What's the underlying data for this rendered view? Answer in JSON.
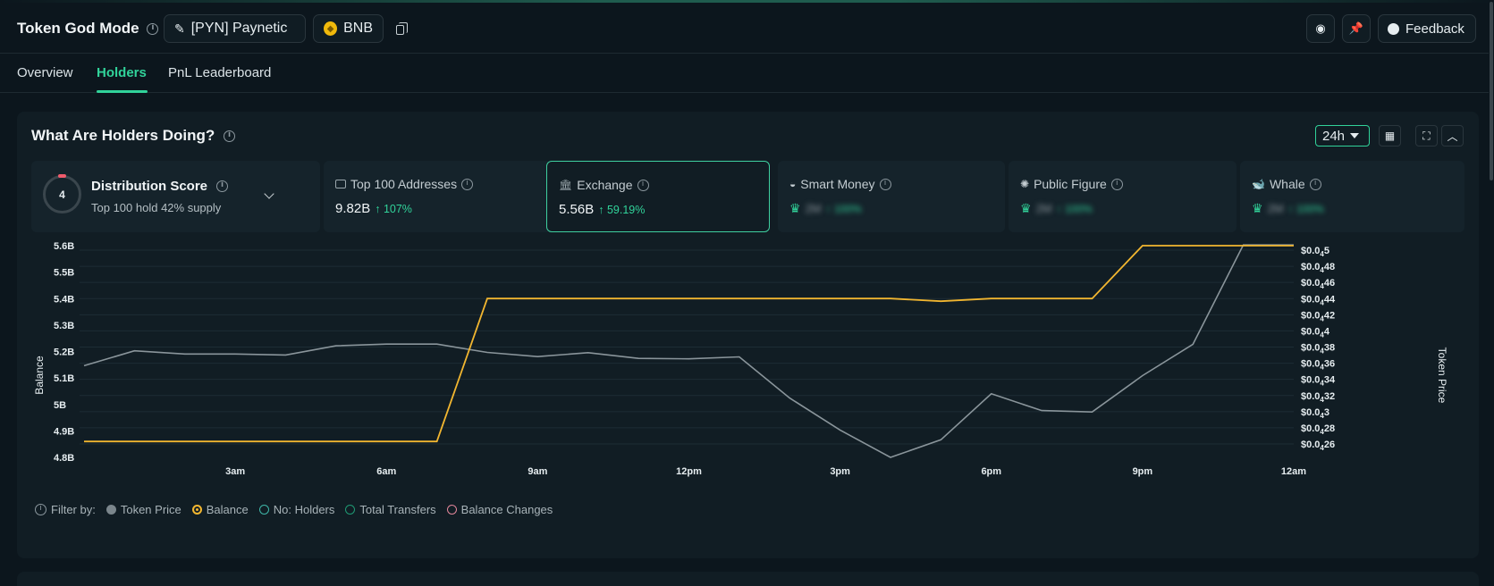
{
  "header": {
    "title": "Token God Mode",
    "token_label": "[PYN] Paynetic",
    "chain_label": "BNB",
    "feedback_label": "Feedback"
  },
  "tabs": [
    {
      "label": "Overview",
      "active": false
    },
    {
      "label": "Holders",
      "active": true
    },
    {
      "label": "PnL Leaderboard",
      "active": false
    }
  ],
  "panel": {
    "title": "What Are Holders Doing?",
    "range": "24h"
  },
  "distribution": {
    "score": "4",
    "title": "Distribution Score",
    "subtitle": "Top 100 hold 42% supply"
  },
  "cards": [
    {
      "label": "Top 100 Addresses",
      "value": "9.82B",
      "change": "107%",
      "locked": false,
      "selected": false
    },
    {
      "label": "Exchange",
      "value": "5.56B",
      "change": "59.19%",
      "locked": false,
      "selected": true
    },
    {
      "label": "Smart Money",
      "value": "2M",
      "change": "100%",
      "locked": true,
      "selected": false
    },
    {
      "label": "Public Figure",
      "value": "2M",
      "change": "100%",
      "locked": true,
      "selected": false
    },
    {
      "label": "Whale",
      "value": "2M",
      "change": "100%",
      "locked": true,
      "selected": false
    }
  ],
  "chart_data": {
    "type": "line",
    "x": [
      "12am",
      "1am",
      "2am",
      "3am",
      "4am",
      "5am",
      "6am",
      "7am",
      "8am",
      "9am",
      "10am",
      "11am",
      "12pm",
      "1pm",
      "2pm",
      "3pm",
      "4pm",
      "5pm",
      "6pm",
      "7pm",
      "8pm",
      "9pm",
      "10pm",
      "11pm",
      "12am"
    ],
    "x_tick_labels": [
      "3am",
      "6am",
      "9am",
      "12pm",
      "3pm",
      "6pm",
      "9pm",
      "12am"
    ],
    "y_left_label": "Balance",
    "y_left_ticks": [
      "5.6B",
      "5.5B",
      "5.4B",
      "5.3B",
      "5.2B",
      "5.1B",
      "5B",
      "4.9B",
      "4.8B"
    ],
    "y_left_range_billions": [
      4.8,
      5.6
    ],
    "y_right_label": "Token Price",
    "y_right_ticks": [
      {
        "prefix": "$0.0",
        "sub": "4",
        "rest": "5"
      },
      {
        "prefix": "$0.0",
        "sub": "4",
        "rest": "48"
      },
      {
        "prefix": "$0.0",
        "sub": "4",
        "rest": "46"
      },
      {
        "prefix": "$0.0",
        "sub": "4",
        "rest": "44"
      },
      {
        "prefix": "$0.0",
        "sub": "4",
        "rest": "42"
      },
      {
        "prefix": "$0.0",
        "sub": "4",
        "rest": "4"
      },
      {
        "prefix": "$0.0",
        "sub": "4",
        "rest": "38"
      },
      {
        "prefix": "$0.0",
        "sub": "4",
        "rest": "36"
      },
      {
        "prefix": "$0.0",
        "sub": "4",
        "rest": "34"
      },
      {
        "prefix": "$0.0",
        "sub": "4",
        "rest": "32"
      },
      {
        "prefix": "$0.0",
        "sub": "4",
        "rest": "3"
      },
      {
        "prefix": "$0.0",
        "sub": "4",
        "rest": "28"
      },
      {
        "prefix": "$0.0",
        "sub": "4",
        "rest": "26"
      }
    ],
    "y_right_range": [
      2.6e-06,
      5e-06
    ],
    "series": [
      {
        "name": "Token Price",
        "color": "#8a959b",
        "values": [
          3.569e-06,
          3.754e-06,
          3.714e-06,
          3.714e-06,
          3.702e-06,
          3.816e-06,
          3.836e-06,
          3.836e-06,
          3.734e-06,
          3.682e-06,
          3.73e-06,
          3.66e-06,
          3.654e-06,
          3.678e-06,
          3.168e-06,
          2.772e-06,
          2.434e-06,
          2.652e-06,
          3.222e-06,
          3.014e-06,
          2.996e-06,
          3.446e-06,
          3.834e-06,
          5.064e-06,
          5.064e-06
        ]
      },
      {
        "name": "Balance",
        "color": "#f2b630",
        "values": [
          4.86,
          4.86,
          4.86,
          4.86,
          4.86,
          4.86,
          4.86,
          4.86,
          5.4,
          5.4,
          5.4,
          5.4,
          5.4,
          5.4,
          5.4,
          5.4,
          5.4,
          5.39,
          5.4,
          5.4,
          5.4,
          5.6,
          5.6,
          5.6,
          5.6
        ]
      }
    ],
    "grid": true
  },
  "filters": {
    "label": "Filter by:",
    "items": [
      {
        "label": "Token Price",
        "color": "#7b868c",
        "on": true
      },
      {
        "label": "Balance",
        "color": "#f2b630",
        "on": true
      },
      {
        "label": "No: Holders",
        "color": "#3fb6a8",
        "on": false
      },
      {
        "label": "Total Transfers",
        "color": "#1f9a74",
        "on": false
      },
      {
        "label": "Balance Changes",
        "color": "#e2869a",
        "on": false
      }
    ]
  }
}
